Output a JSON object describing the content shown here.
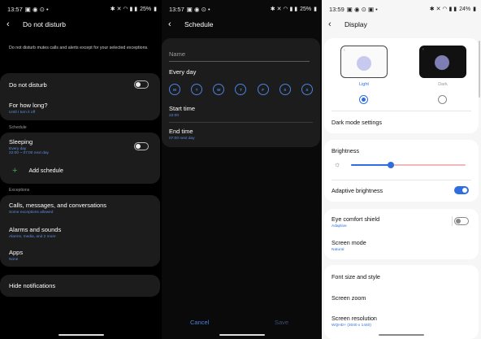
{
  "panel1": {
    "status": {
      "time": "13:57",
      "battery": "25%"
    },
    "title": "Do not disturb",
    "description": "Do not disturb mutes calls and alerts except for your selected exceptions.",
    "dnd": {
      "label": "Do not disturb",
      "on": false
    },
    "how_long": {
      "label": "For how long?",
      "value": "Until I turn it off"
    },
    "schedule_section": "Schedule",
    "sleeping": {
      "label": "Sleeping",
      "line1": "Every day",
      "line2": "22:00 ~ 07:00 next day",
      "on": false
    },
    "add_schedule": "Add schedule",
    "exceptions_section": "Exceptions",
    "calls": {
      "label": "Calls, messages, and conversations",
      "sub": "Some exceptions allowed"
    },
    "alarms": {
      "label": "Alarms and sounds",
      "sub": "Alarms, media, and 2 more"
    },
    "apps": {
      "label": "Apps",
      "sub": "None"
    },
    "hide_notifications": "Hide notifications"
  },
  "panel2": {
    "status": {
      "time": "13:57",
      "battery": "25%"
    },
    "title": "Schedule",
    "name_placeholder": "Name",
    "every_day": "Every day",
    "days": [
      "M",
      "T",
      "W",
      "T",
      "F",
      "S",
      "S"
    ],
    "start": {
      "label": "Start time",
      "value": "22:00"
    },
    "end": {
      "label": "End time",
      "value": "07:00 next day"
    },
    "cancel": "Cancel",
    "save": "Save"
  },
  "panel3": {
    "status": {
      "time": "13:59",
      "battery": "24%"
    },
    "title": "Display",
    "light_label": "Light",
    "dark_label": "Dark",
    "dark_mode_settings": "Dark mode settings",
    "brightness": {
      "label": "Brightness",
      "level": 0.35
    },
    "adaptive": {
      "label": "Adaptive brightness",
      "on": true
    },
    "eye_comfort": {
      "label": "Eye comfort shield",
      "sub": "Adaptive",
      "on": false
    },
    "screen_mode": {
      "label": "Screen mode",
      "sub": "Natural"
    },
    "font": "Font size and style",
    "zoom": "Screen zoom",
    "resolution": {
      "label": "Screen resolution",
      "sub": "WQHD+ (3040 x 1440)"
    }
  },
  "colors": {
    "accent": "#2f6ee0",
    "dark_card": "#1c1c1c",
    "light_bg": "#f6f6f6"
  }
}
